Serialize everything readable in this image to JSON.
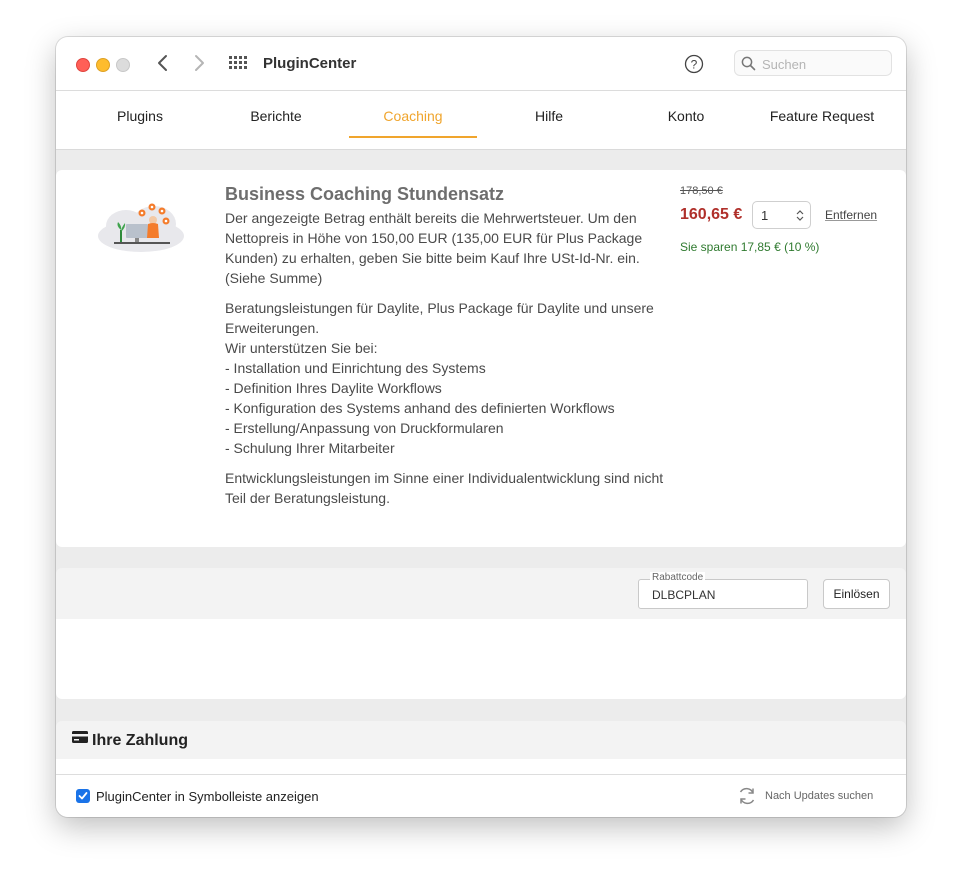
{
  "titlebar": {
    "app_title": "PluginCenter",
    "search": {
      "placeholder": "Suchen",
      "value": ""
    }
  },
  "tabs": [
    {
      "label": "Plugins",
      "active": false
    },
    {
      "label": "Berichte",
      "active": false
    },
    {
      "label": "Coaching",
      "active": true
    },
    {
      "label": "Hilfe",
      "active": false
    },
    {
      "label": "Konto",
      "active": false
    },
    {
      "label": "Feature Request",
      "active": false
    }
  ],
  "product": {
    "title": "Business Coaching Stundensatz",
    "paragraphs": [
      "Der angezeigte Betrag enthält bereits die Mehrwertsteuer. Um den Nettopreis in Höhe von 150,00 EUR (135,00 EUR für Plus Package Kunden) zu erhalten, geben Sie bitte beim Kauf Ihre USt-Id-Nr. ein. (Siehe Summe)",
      "Beratungsleistungen für Daylite, Plus Package für Daylite und unsere Erweiterungen.\nWir unterstützen Sie bei:\n- Installation und Einrichtung des Systems\n- Definition Ihres Daylite Workflows\n- Konfiguration des Systems anhand des definierten Workflows\n- Erstellung/Anpassung von Druckformularen\n- Schulung Ihrer Mitarbeiter",
      "Entwicklungsleistungen im Sinne einer Individualentwicklung sind nicht Teil der Beratungsleistung."
    ],
    "old_price": "178,50 €",
    "new_price": "160,65 €",
    "quantity": "1",
    "remove_label": "Entfernen",
    "savings": "Sie sparen 17,85 € (10 %)"
  },
  "coupon": {
    "label": "Rabattcode",
    "value": "DLBCPLAN",
    "button_label": "Einlösen"
  },
  "payment": {
    "title": "Ihre Zahlung"
  },
  "footer": {
    "checkbox_label": "PluginCenter in Symbolleiste anzeigen",
    "checkbox_checked": true,
    "update_label": "Nach Updates suchen"
  },
  "colors": {
    "accent": "#f0a52d",
    "price": "#b0302b",
    "savings": "#2f7a2f",
    "checkbox": "#1a73e8"
  },
  "icons": [
    "close-window-icon",
    "minimize-window-icon",
    "zoom-window-icon",
    "back-arrow-icon",
    "forward-arrow-icon",
    "app-grid-icon",
    "help-icon",
    "search-icon",
    "coaching-illustration",
    "stepper-icon",
    "credit-card-icon",
    "checkmark-icon",
    "refresh-icon"
  ]
}
